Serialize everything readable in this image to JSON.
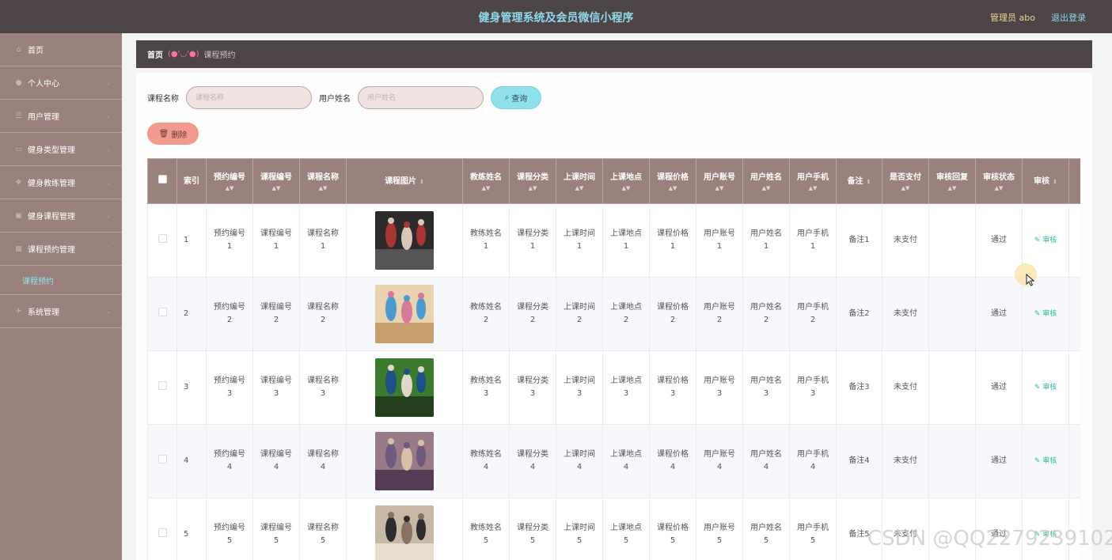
{
  "header": {
    "title": "健身管理系统及会员微信小程序",
    "admin_label": "管理员 abo",
    "logout_label": "退出登录"
  },
  "sidebar": {
    "items": [
      {
        "label": "首页",
        "icon": "home-icon"
      },
      {
        "label": "个人中心",
        "icon": "user-icon"
      },
      {
        "label": "用户管理",
        "icon": "list-icon"
      },
      {
        "label": "健身类型管理",
        "icon": "card-icon"
      },
      {
        "label": "健身教练管理",
        "icon": "coach-icon"
      },
      {
        "label": "健身课程管理",
        "icon": "course-icon"
      },
      {
        "label": "课程预约管理",
        "icon": "grid-icon"
      },
      {
        "label": "系统管理",
        "icon": "system-icon"
      }
    ],
    "active_sub": "课程预约"
  },
  "breadcrumb": {
    "home": "首页",
    "face": "(●'◡'●)",
    "current": "课程预约"
  },
  "search": {
    "course_label": "课程名称",
    "course_placeholder": "课程名称",
    "user_label": "用户姓名",
    "user_placeholder": "用户姓名",
    "button": "查询"
  },
  "toolbar": {
    "delete_label": "删除"
  },
  "table": {
    "columns": [
      "索引",
      "预约编号",
      "课程编号",
      "课程名称",
      "课程图片",
      "教练姓名",
      "课程分类",
      "上课时间",
      "上课地点",
      "课程价格",
      "用户账号",
      "用户姓名",
      "用户手机",
      "备注",
      "是否支付",
      "审核回复",
      "审核状态",
      "审核"
    ],
    "action_label": "审核",
    "rows": [
      {
        "index": "1",
        "booking_no": "预约编号",
        "booking_no_n": "1",
        "course_no": "课程编号",
        "course_no_n": "1",
        "course_name": "课程名称",
        "course_name_n": "1",
        "coach": "教练姓名",
        "coach_n": "1",
        "category": "课程分类",
        "category_n": "1",
        "time": "上课时间",
        "time_n": "1",
        "place": "上课地点",
        "place_n": "1",
        "price": "课程价格",
        "price_n": "1",
        "account": "用户账号",
        "account_n": "1",
        "uname": "用户姓名",
        "uname_n": "1",
        "phone": "用户手机",
        "phone_n": "1",
        "note": "备注1",
        "paid": "未支付",
        "reply": "",
        "status": "通过"
      },
      {
        "index": "2",
        "booking_no": "预约编号",
        "booking_no_n": "2",
        "course_no": "课程编号",
        "course_no_n": "2",
        "course_name": "课程名称",
        "course_name_n": "2",
        "coach": "教练姓名",
        "coach_n": "2",
        "category": "课程分类",
        "category_n": "2",
        "time": "上课时间",
        "time_n": "2",
        "place": "上课地点",
        "place_n": "2",
        "price": "课程价格",
        "price_n": "2",
        "account": "用户账号",
        "account_n": "2",
        "uname": "用户姓名",
        "uname_n": "2",
        "phone": "用户手机",
        "phone_n": "2",
        "note": "备注2",
        "paid": "未支付",
        "reply": "",
        "status": "通过"
      },
      {
        "index": "3",
        "booking_no": "预约编号",
        "booking_no_n": "3",
        "course_no": "课程编号",
        "course_no_n": "3",
        "course_name": "课程名称",
        "course_name_n": "3",
        "coach": "教练姓名",
        "coach_n": "3",
        "category": "课程分类",
        "category_n": "3",
        "time": "上课时间",
        "time_n": "3",
        "place": "上课地点",
        "place_n": "3",
        "price": "课程价格",
        "price_n": "3",
        "account": "用户账号",
        "account_n": "3",
        "uname": "用户姓名",
        "uname_n": "3",
        "phone": "用户手机",
        "phone_n": "3",
        "note": "备注3",
        "paid": "未支付",
        "reply": "",
        "status": "通过"
      },
      {
        "index": "4",
        "booking_no": "预约编号",
        "booking_no_n": "4",
        "course_no": "课程编号",
        "course_no_n": "4",
        "course_name": "课程名称",
        "course_name_n": "4",
        "coach": "教练姓名",
        "coach_n": "4",
        "category": "课程分类",
        "category_n": "4",
        "time": "上课时间",
        "time_n": "4",
        "place": "上课地点",
        "place_n": "4",
        "price": "课程价格",
        "price_n": "4",
        "account": "用户账号",
        "account_n": "4",
        "uname": "用户姓名",
        "uname_n": "4",
        "phone": "用户手机",
        "phone_n": "4",
        "note": "备注4",
        "paid": "未支付",
        "reply": "",
        "status": "通过"
      },
      {
        "index": "5",
        "booking_no": "预约编号",
        "booking_no_n": "5",
        "course_no": "课程编号",
        "course_no_n": "5",
        "course_name": "课程名称",
        "course_name_n": "5",
        "coach": "教练姓名",
        "coach_n": "5",
        "category": "课程分类",
        "category_n": "5",
        "time": "上课时间",
        "time_n": "5",
        "place": "上课地点",
        "place_n": "5",
        "price": "课程价格",
        "price_n": "5",
        "account": "用户账号",
        "account_n": "5",
        "uname": "用户姓名",
        "uname_n": "5",
        "phone": "用户手机",
        "phone_n": "5",
        "note": "备注5",
        "paid": "未支付",
        "reply": "",
        "status": "通过"
      }
    ]
  },
  "watermark": "CSDN @QQ2279239102",
  "colors": {
    "header_bg": "#4c4446",
    "sidebar_bg": "#9b817c",
    "title_cyan": "#8fd9ea",
    "admin_gold": "#f0d59b",
    "delete_pink": "#f19a8d",
    "search_cyan": "#8fdfec",
    "audit_teal": "#32b7a4"
  }
}
